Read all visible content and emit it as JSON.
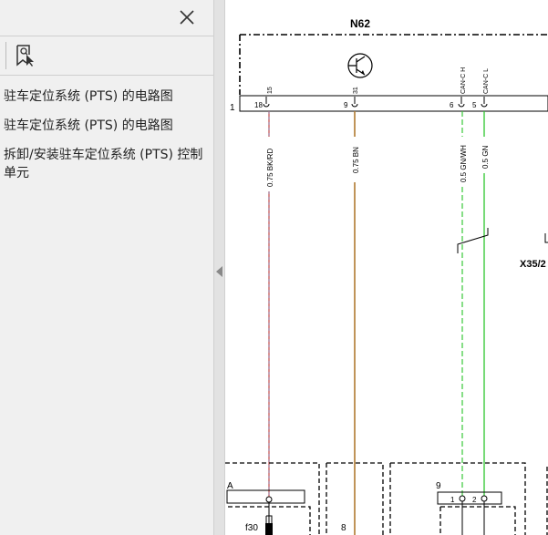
{
  "sidebar": {
    "close_icon": "close-icon",
    "bookmark_icon": "bookmark-search-icon",
    "items": [
      "驻车定位系统 (PTS) 的电路图",
      "驻车定位系统 (PTS) 的电路图",
      "拆卸/安装驻车定位系统 (PTS) 控制单元"
    ]
  },
  "diagram": {
    "module_label": "N62",
    "connector_row": "1",
    "pins": [
      "18",
      "9",
      "6",
      "5"
    ],
    "signals": [
      "15",
      "31",
      "CAN-C H",
      "CAN-C L"
    ],
    "wires": [
      "0.75 BK/RD",
      "0.75 BN",
      "0.5 GN/WH",
      "0.5 GN"
    ],
    "connector_x": "X35/2",
    "bottom_a": "A",
    "bottom_f": "f30",
    "bottom_8": "8",
    "bottom_9": "9",
    "bottom_pin1": "1",
    "bottom_pin2": "2",
    "colors": {
      "bk_rd": "#c65a5a",
      "bn": "#b07a30",
      "gn": "#2ec62e",
      "gn_wh": "#37c837"
    }
  }
}
